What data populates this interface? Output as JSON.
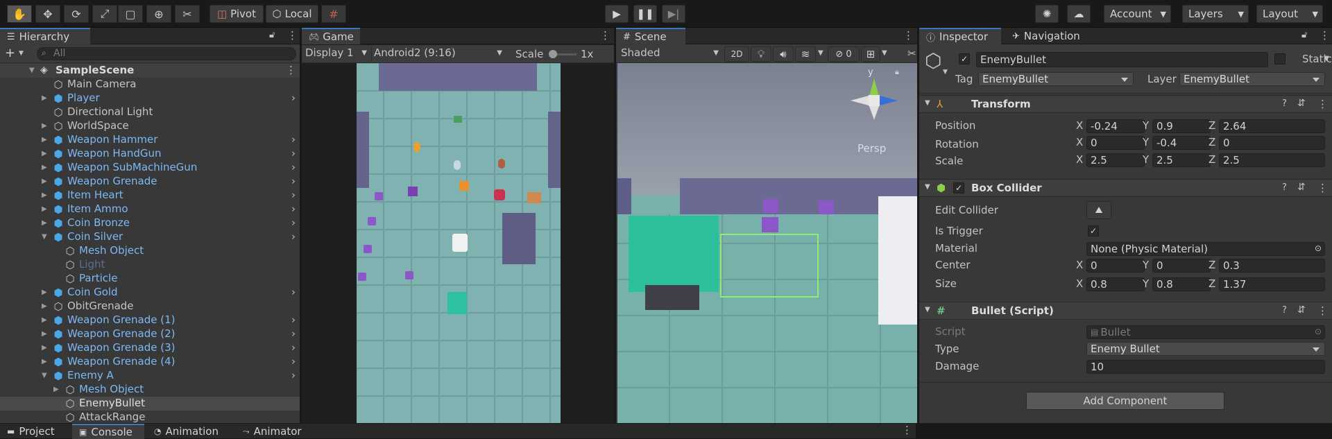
{
  "toolbar": {
    "tools": [
      "hand-tool-icon",
      "move-tool-icon",
      "rotate-tool-icon",
      "rect-scale-tool-icon",
      "rect-tool-icon",
      "transform-tool-icon",
      "custom-tool-icon"
    ],
    "pivot": "Pivot",
    "local": "Local",
    "account": "Account",
    "layers": "Layers",
    "layout": "Layout"
  },
  "hierarchy": {
    "tab": "Hierarchy",
    "search_placeholder": "All",
    "scene": "SampleScene",
    "rows": [
      {
        "label": "Main Camera",
        "depth": 1,
        "prefab": false,
        "arrow": "",
        "chev": false,
        "dim": false
      },
      {
        "label": "Player",
        "depth": 1,
        "prefab": true,
        "arrow": "right",
        "chev": true,
        "dim": false
      },
      {
        "label": "Directional Light",
        "depth": 1,
        "prefab": false,
        "arrow": "",
        "chev": false,
        "dim": false
      },
      {
        "label": "WorldSpace",
        "depth": 1,
        "prefab": false,
        "arrow": "right",
        "chev": false,
        "dim": false
      },
      {
        "label": "Weapon Hammer",
        "depth": 1,
        "prefab": true,
        "arrow": "right",
        "chev": true,
        "dim": false
      },
      {
        "label": "Weapon HandGun",
        "depth": 1,
        "prefab": true,
        "arrow": "right",
        "chev": true,
        "dim": false
      },
      {
        "label": "Weapon SubMachineGun",
        "depth": 1,
        "prefab": true,
        "arrow": "right",
        "chev": true,
        "dim": false
      },
      {
        "label": "Weapon Grenade",
        "depth": 1,
        "prefab": true,
        "arrow": "right",
        "chev": true,
        "dim": false
      },
      {
        "label": "Item Heart",
        "depth": 1,
        "prefab": true,
        "arrow": "right",
        "chev": true,
        "dim": false
      },
      {
        "label": "Item Ammo",
        "depth": 1,
        "prefab": true,
        "arrow": "right",
        "chev": true,
        "dim": false
      },
      {
        "label": "Coin Bronze",
        "depth": 1,
        "prefab": true,
        "arrow": "right",
        "chev": true,
        "dim": false
      },
      {
        "label": "Coin Silver",
        "depth": 1,
        "prefab": true,
        "arrow": "down",
        "chev": true,
        "dim": false
      },
      {
        "label": "Mesh Object",
        "depth": 2,
        "prefab": false,
        "arrow": "",
        "chev": false,
        "dim": false,
        "blue": true
      },
      {
        "label": "Light",
        "depth": 2,
        "prefab": false,
        "arrow": "",
        "chev": false,
        "dim": true
      },
      {
        "label": "Particle",
        "depth": 2,
        "prefab": false,
        "arrow": "",
        "chev": false,
        "dim": false,
        "blue": true
      },
      {
        "label": "Coin Gold",
        "depth": 1,
        "prefab": true,
        "arrow": "right",
        "chev": true,
        "dim": false
      },
      {
        "label": "ObitGrenade",
        "depth": 1,
        "prefab": false,
        "arrow": "right",
        "chev": false,
        "dim": false
      },
      {
        "label": "Weapon Grenade (1)",
        "depth": 1,
        "prefab": true,
        "arrow": "right",
        "chev": true,
        "dim": false
      },
      {
        "label": "Weapon Grenade (2)",
        "depth": 1,
        "prefab": true,
        "arrow": "right",
        "chev": true,
        "dim": false
      },
      {
        "label": "Weapon Grenade (3)",
        "depth": 1,
        "prefab": true,
        "arrow": "right",
        "chev": true,
        "dim": false
      },
      {
        "label": "Weapon Grenade (4)",
        "depth": 1,
        "prefab": true,
        "arrow": "right",
        "chev": true,
        "dim": false
      },
      {
        "label": "Enemy A",
        "depth": 1,
        "prefab": true,
        "arrow": "down",
        "chev": true,
        "dim": false
      },
      {
        "label": "Mesh Object",
        "depth": 2,
        "prefab": false,
        "arrow": "right",
        "chev": false,
        "dim": false,
        "blue": true
      },
      {
        "label": "EnemyBullet",
        "depth": 2,
        "prefab": false,
        "arrow": "",
        "chev": false,
        "dim": false,
        "selected": true
      },
      {
        "label": "AttackRange",
        "depth": 2,
        "prefab": false,
        "arrow": "",
        "chev": false,
        "dim": false
      }
    ]
  },
  "game": {
    "tab": "Game",
    "display": "Display 1",
    "resolution": "Android2 (9:16)",
    "scale_label": "Scale",
    "scale_value": "1x"
  },
  "scene": {
    "tab": "Scene",
    "shading": "Shaded",
    "mode_2d": "2D",
    "hidden_count": "0",
    "gizmo_y": "y",
    "persp": "Persp"
  },
  "inspector": {
    "tab": "Inspector",
    "nav_tab": "Navigation",
    "object_name": "EnemyBullet",
    "static_label": "Static",
    "tag_label": "Tag",
    "tag_value": "EnemyBullet",
    "layer_label": "Layer",
    "layer_value": "EnemyBullet",
    "transform": {
      "title": "Transform",
      "position_label": "Position",
      "rotation_label": "Rotation",
      "scale_label": "Scale",
      "position": [
        "-0.24",
        "0.9",
        "2.64"
      ],
      "rotation": [
        "0",
        "-0.4",
        "0"
      ],
      "scale": [
        "2.5",
        "2.5",
        "2.5"
      ]
    },
    "box_collider": {
      "title": "Box Collider",
      "edit_label": "Edit Collider",
      "trigger_label": "Is Trigger",
      "material_label": "Material",
      "material_value": "None (Physic Material)",
      "center_label": "Center",
      "center": [
        "0",
        "0",
        "0.3"
      ],
      "size_label": "Size",
      "size": [
        "0.8",
        "0.8",
        "1.37"
      ]
    },
    "bullet": {
      "title": "Bullet (Script)",
      "script_label": "Script",
      "script_value": "Bullet",
      "type_label": "Type",
      "type_value": "Enemy Bullet",
      "damage_label": "Damage",
      "damage_value": "10"
    },
    "add_component": "Add Component",
    "axis": [
      "X",
      "Y",
      "Z"
    ]
  },
  "bottom_tabs": {
    "project": "Project",
    "console": "Console",
    "animation": "Animation",
    "animator": "Animator"
  }
}
